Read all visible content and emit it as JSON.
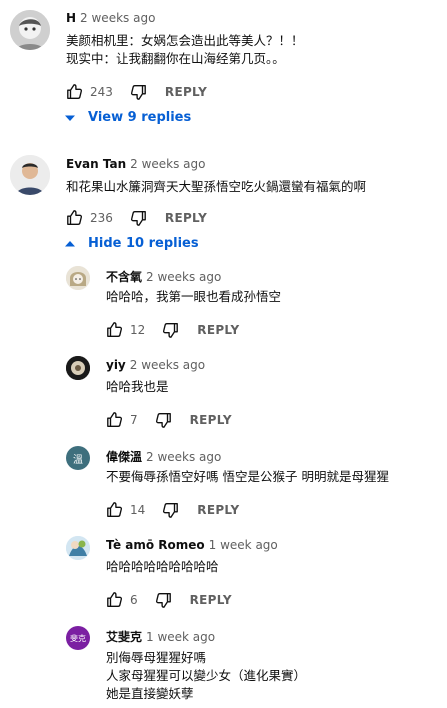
{
  "comments": [
    {
      "author": "H",
      "time": "2 weeks ago",
      "lines": "美颜相机里：女娲怎会造出此等美人？！！\n现实中：让我翻翻你在山海经第几页。。",
      "likes": "243",
      "reply_label": "REPLY",
      "toggle_label": "View 9 replies"
    },
    {
      "author": "Evan Tan",
      "time": "2 weeks ago",
      "lines": "和花果山水簾洞齊天大聖孫悟空吃火鍋還蠻有福氣的啊",
      "likes": "236",
      "reply_label": "REPLY",
      "toggle_label": "Hide 10 replies"
    }
  ],
  "replies": [
    {
      "author": "不含氧",
      "time": "2 weeks ago",
      "text": "哈哈哈，我第一眼也看成孙悟空",
      "likes": "12",
      "reply_label": "REPLY"
    },
    {
      "author": "yiy",
      "time": "2 weeks ago",
      "text": "哈哈我也是",
      "likes": "7",
      "reply_label": "REPLY"
    },
    {
      "author": "偉傑溫",
      "avatar_text": "溫",
      "time": "2 weeks ago",
      "text": "不要侮辱孫悟空好嗎 悟空是公猴子 明明就是母猩猩",
      "likes": "14",
      "reply_label": "REPLY"
    },
    {
      "author": "Tè amō Romeo",
      "time": "1 week ago",
      "text": "哈哈哈哈哈哈哈哈哈",
      "likes": "6",
      "reply_label": "REPLY"
    },
    {
      "author": "艾斐克",
      "avatar_text": "斐克",
      "time": "1 week ago",
      "text": "別侮辱母猩猩好嗎\n人家母猩猩可以變少女（進化果實）\n她是直接變妖孽"
    }
  ],
  "colors": {
    "link_blue": "#065fd4",
    "secondary_text": "#606060",
    "avatar_wen": "#3e6f7d",
    "avatar_feike": "#7b1fa2"
  }
}
